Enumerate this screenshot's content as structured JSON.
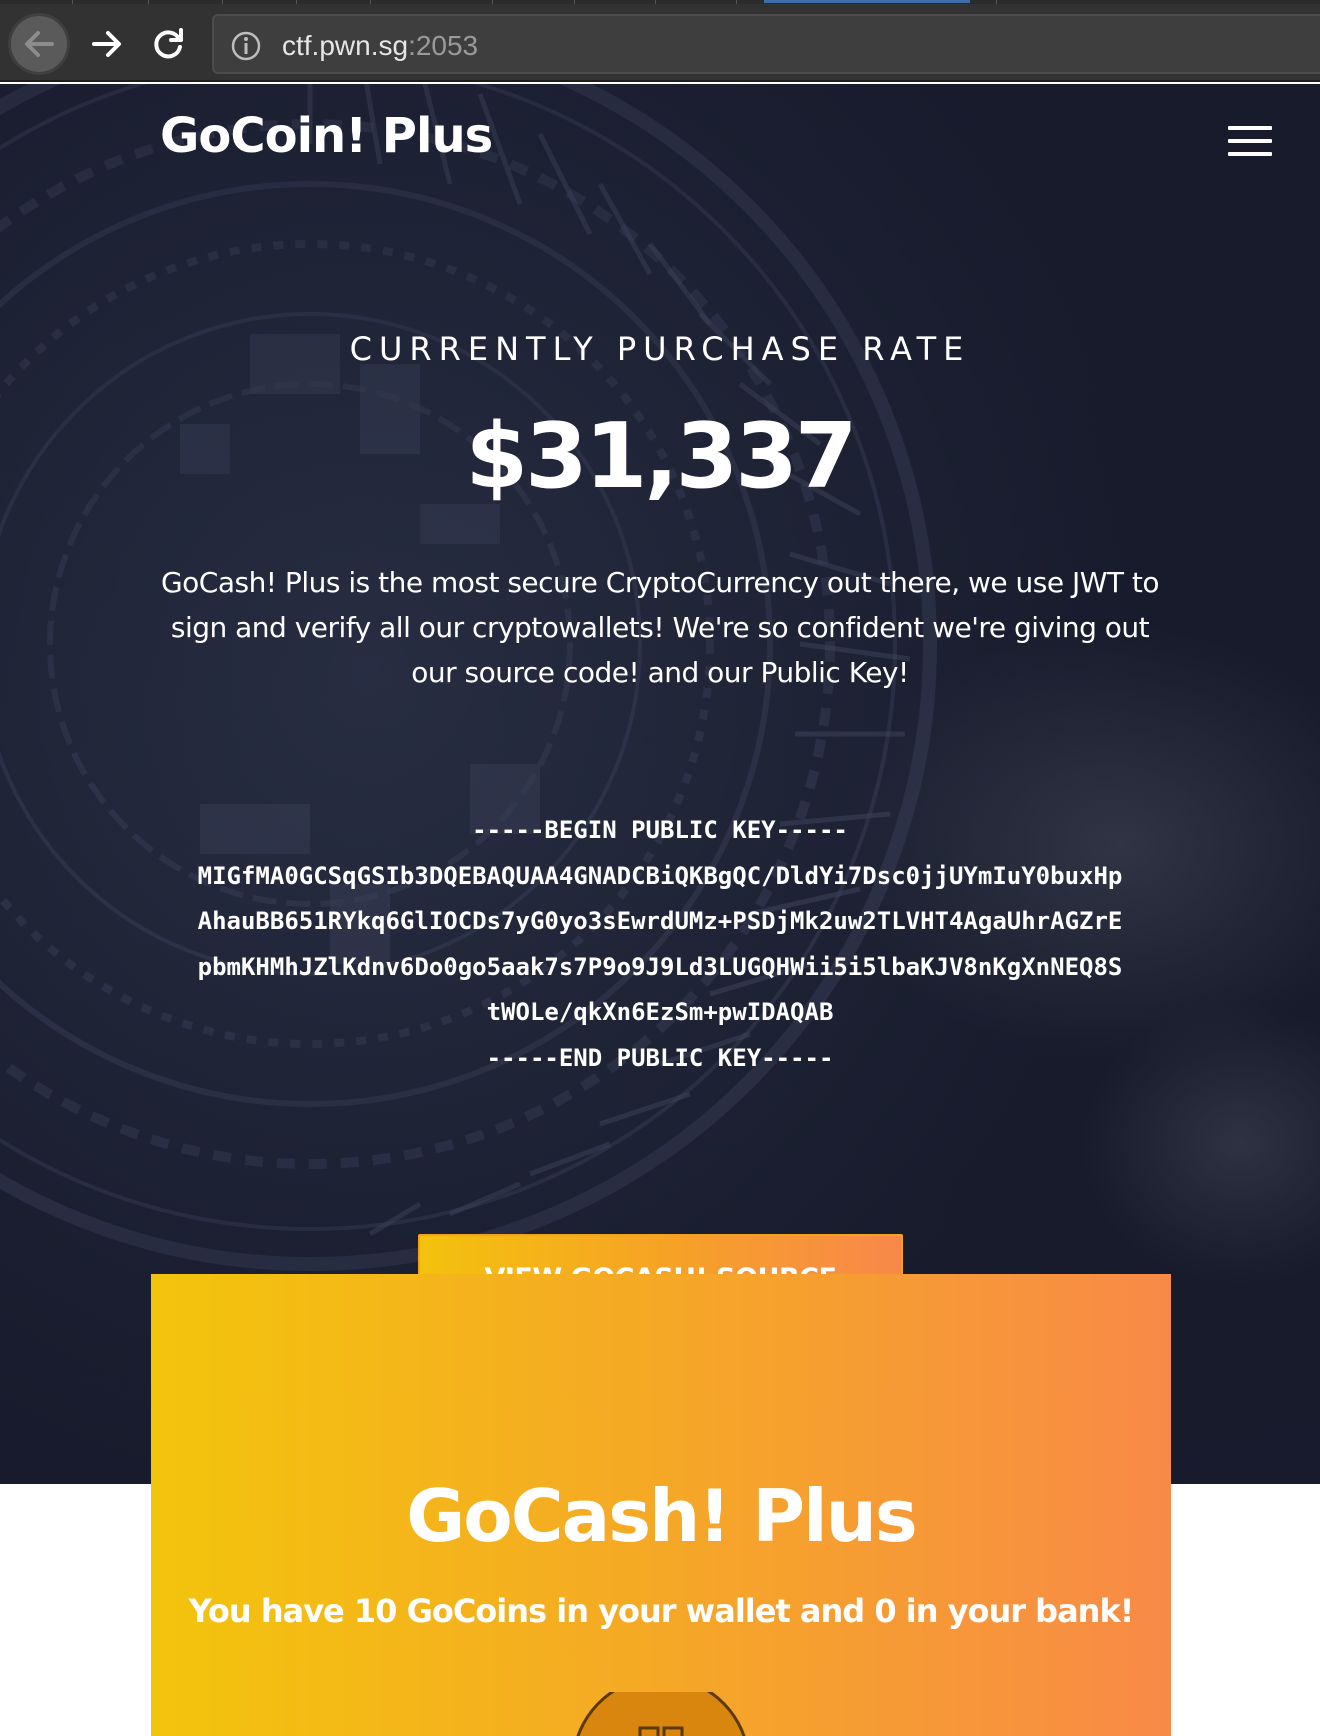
{
  "browser": {
    "url_host": "ctf.pwn.sg",
    "url_port": ":2053",
    "icons": [
      "back-arrow-icon",
      "forward-arrow-icon",
      "reload-icon",
      "info-icon"
    ]
  },
  "hero": {
    "brand": "GoCoin! Plus",
    "eyebrow": "CURRENTLY PURCHASE RATE",
    "rate": "$31,337",
    "intro": "GoCash! Plus is the most secure CryptoCurrency out there, we use JWT to sign and verify all our cryptowallets! We're so confident we're giving out our source code! and our Public Key!",
    "public_key": [
      "-----BEGIN PUBLIC KEY-----",
      "MIGfMA0GCSqGSIb3DQEBAQUAA4GNADCBiQKBgQC/DldYi7Dsc0jjUYmIuY0buxHp",
      "AhauBB651RYkq6GlIOCDs7yG0yo3sEwrdUMz+PSDjMk2uw2TLVHT4AgaUhrAGZrE",
      "pbmKHMhJZlKdnv6Do0go5aak7s7P9o9J9Ld3LUGQHWii5i5lbaKJV8nKgXnNEQ8S",
      "tWOLe/qkXn6EzSm+pwIDAQAB",
      "-----END PUBLIC KEY-----"
    ],
    "cta_label": "VIEW GOCASH! SOURCE"
  },
  "wallet": {
    "title": "GoCash! Plus",
    "summary": "You have 10 GoCoins in your wallet and 0 in your bank!"
  },
  "colors": {
    "hero_bg": "#171b2c",
    "accent_start": "#f4c20d",
    "accent_end": "#f8884a"
  }
}
